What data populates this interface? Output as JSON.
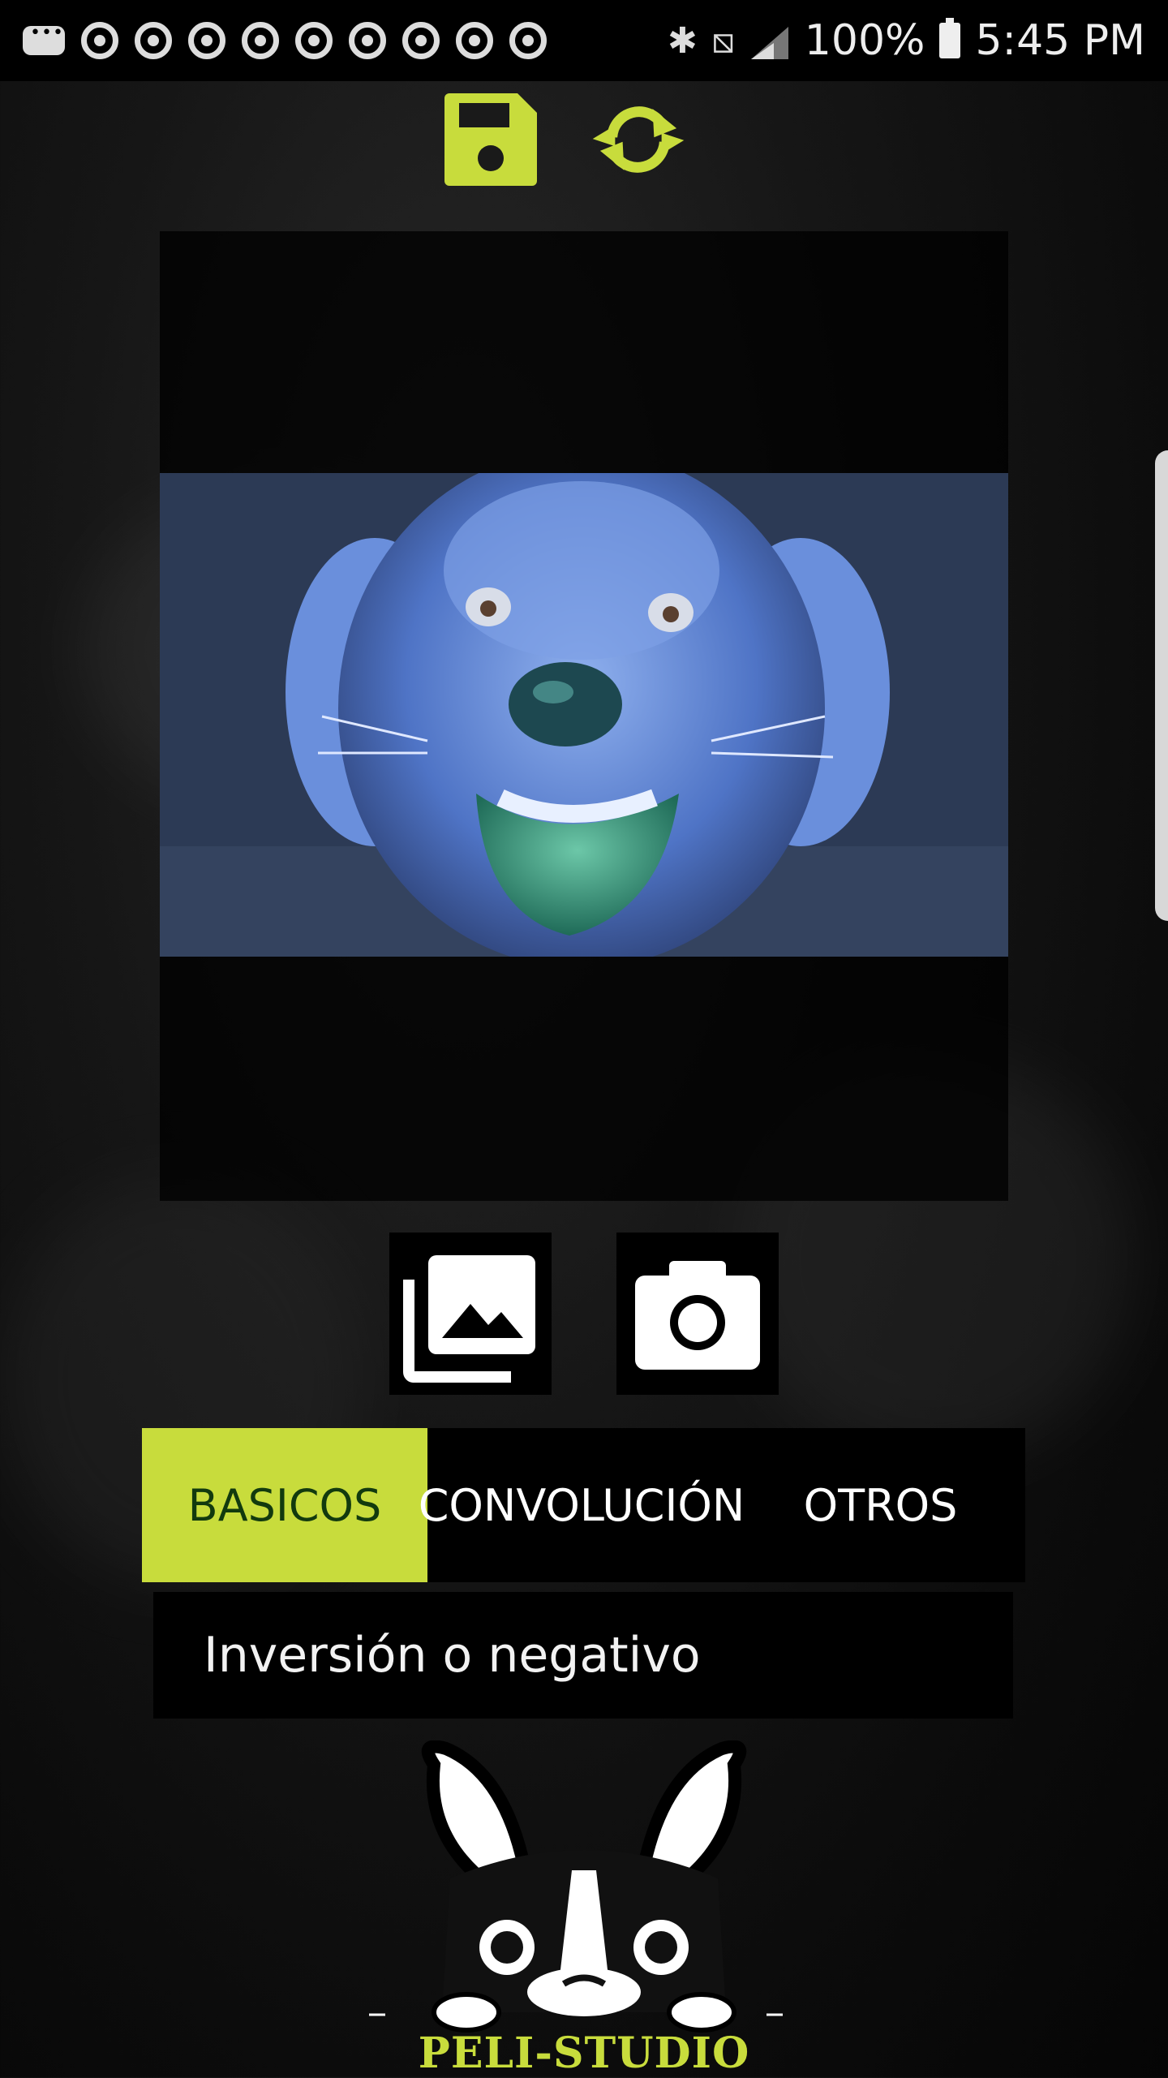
{
  "status_bar": {
    "battery_text": "100%",
    "time": "5:45 PM",
    "icons": [
      "more-notifications-icon",
      "chrome-icon",
      "chrome-icon",
      "chrome-icon",
      "chrome-icon",
      "chrome-icon",
      "chrome-icon",
      "chrome-icon",
      "chrome-icon",
      "chrome-icon",
      "bluetooth-icon",
      "no-vibrate-icon",
      "signal-icon",
      "battery-icon"
    ]
  },
  "toolbar": {
    "save_icon": "save-icon",
    "reset_icon": "refresh-icon",
    "accent": "#c8dc3c"
  },
  "image_picker": {
    "gallery_icon": "gallery-icon",
    "camera_icon": "camera-icon"
  },
  "tabs": [
    {
      "label": "BASICOS",
      "active": true
    },
    {
      "label": "CONVOLUCIÓN",
      "active": false
    },
    {
      "label": "OTROS",
      "active": false
    }
  ],
  "filter": {
    "selected": "Inversión o negativo"
  },
  "logo": {
    "text": "PELI-STUDIO"
  },
  "colors": {
    "accent": "#c8dc3c",
    "tab_active_text": "#123a0e",
    "panel": "#000000"
  }
}
